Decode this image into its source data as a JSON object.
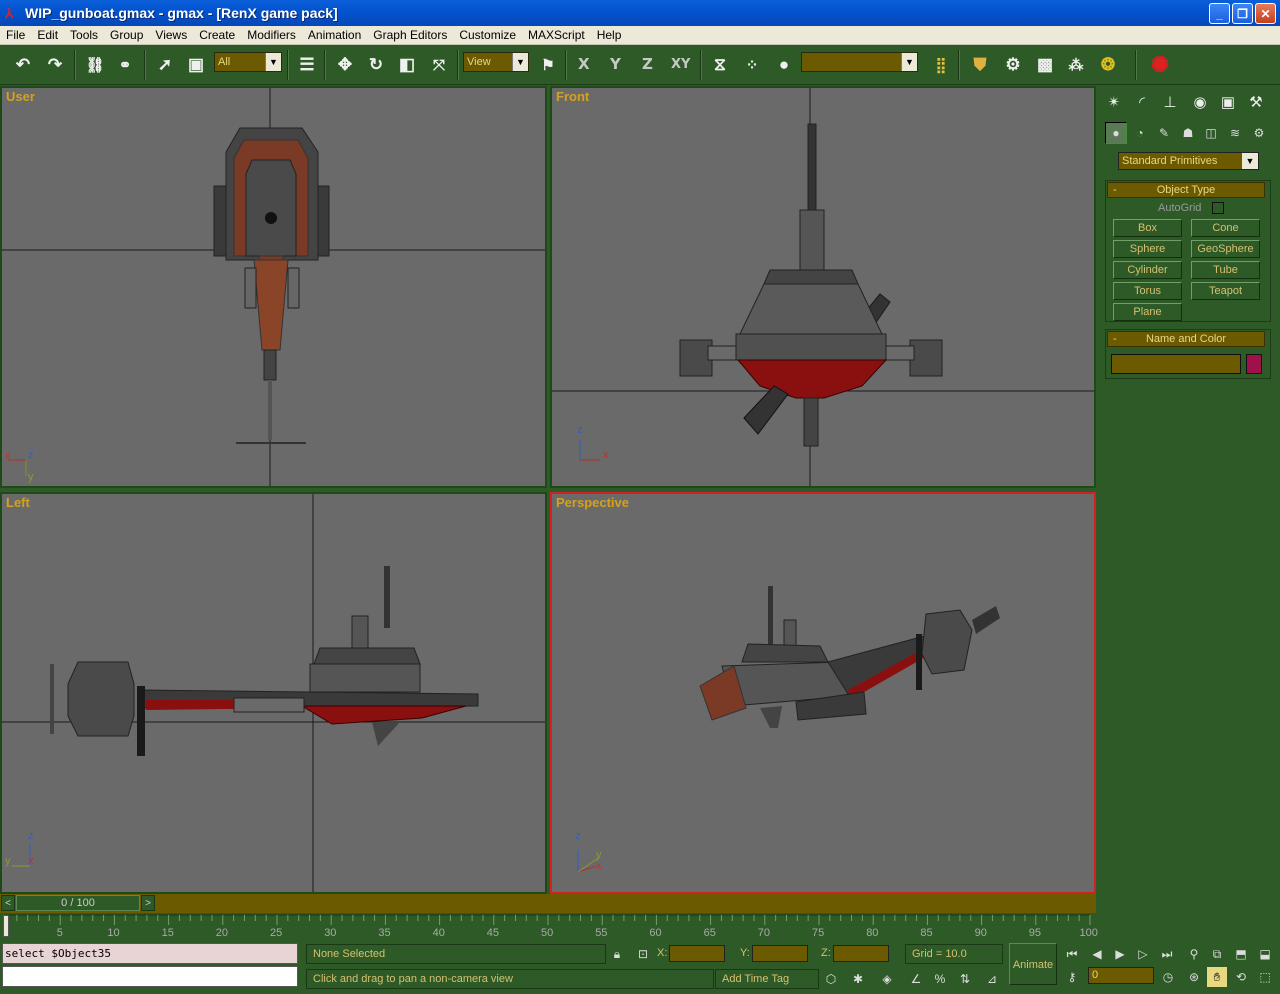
{
  "window": {
    "title": "WIP_gunboat.gmax - gmax - [RenX game pack]",
    "minimize": "_",
    "maximize": "❐",
    "close": "✕"
  },
  "menu": [
    "File",
    "Edit",
    "Tools",
    "Group",
    "Views",
    "Create",
    "Modifiers",
    "Animation",
    "Graph Editors",
    "Customize",
    "MAXScript",
    "Help"
  ],
  "toolbar": {
    "selection_filter": "All",
    "reference_coord": "View",
    "named_selection": "",
    "axis_x": "X",
    "axis_y": "Y",
    "axis_z": "Z",
    "axis_xy": "XY"
  },
  "viewports": {
    "user": "User",
    "front": "Front",
    "left": "Left",
    "perspective": "Perspective",
    "axis_x": "x",
    "axis_y": "y",
    "axis_z": "z"
  },
  "command_panel": {
    "category": "Standard Primitives",
    "object_type_title": "Object Type",
    "autogrid_label": "AutoGrid",
    "primitives": [
      "Box",
      "Cone",
      "Sphere",
      "GeoSphere",
      "Cylinder",
      "Tube",
      "Torus",
      "Teapot",
      "Plane"
    ],
    "name_color_title": "Name and Color",
    "collapse": "-",
    "object_color": "#a0104a"
  },
  "time_slider": {
    "position_label": "0 / 100",
    "prev": "<",
    "next": ">",
    "ticks": [
      "5",
      "10",
      "15",
      "20",
      "25",
      "30",
      "35",
      "40",
      "45",
      "50",
      "55",
      "60",
      "65",
      "70",
      "75",
      "80",
      "85",
      "90",
      "95",
      "100"
    ]
  },
  "status": {
    "listener_text": "select $Object35",
    "selection_status": "None Selected",
    "prompt": "Click and drag to pan a non-camera view",
    "coord_x_label": "X:",
    "coord_y_label": "Y:",
    "coord_z_label": "Z:",
    "grid": "Grid = 10.0",
    "add_time_tag": "Add Time Tag",
    "animate": "Animate",
    "current_frame": "0"
  },
  "colors": {
    "ui_green": "#2d5a27",
    "field_olive": "#6b5a00",
    "label_gold": "#d4a020",
    "viewport_gray": "#6a6a6a",
    "active_border": "#d42020",
    "hull_red": "#8a1010"
  }
}
